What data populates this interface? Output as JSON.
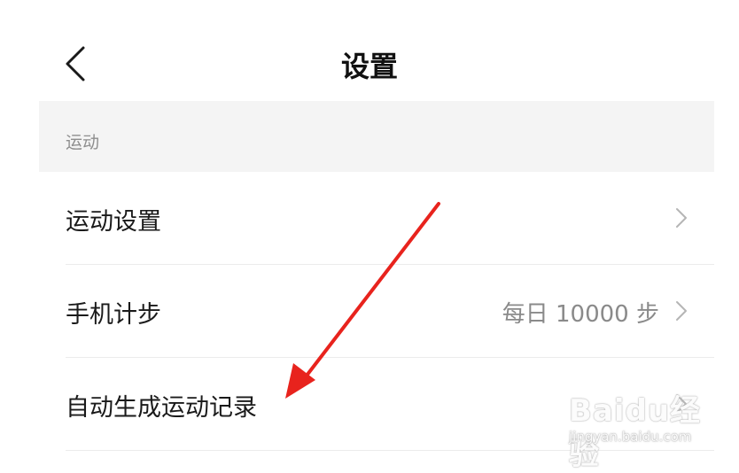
{
  "header": {
    "title": "设置",
    "back_icon": "chevron-left-icon"
  },
  "section": {
    "label": "运动"
  },
  "rows": [
    {
      "label": "运动设置",
      "value": "",
      "icon": "chevron-right-icon"
    },
    {
      "label": "手机计步",
      "value": "每日 10000 步",
      "icon": "chevron-right-icon"
    },
    {
      "label": "自动生成运动记录",
      "value": "",
      "icon": "chevron-right-icon"
    }
  ],
  "annotation": {
    "icon": "red-arrow-icon",
    "color": "#e8231d"
  },
  "watermark": {
    "logo": "Baidu经验",
    "url": "jingyan.baidu.com"
  },
  "colors": {
    "background": "#ffffff",
    "section_bg": "#f4f4f4",
    "secondary_text": "#8a8a8a",
    "divider": "#ececec"
  }
}
